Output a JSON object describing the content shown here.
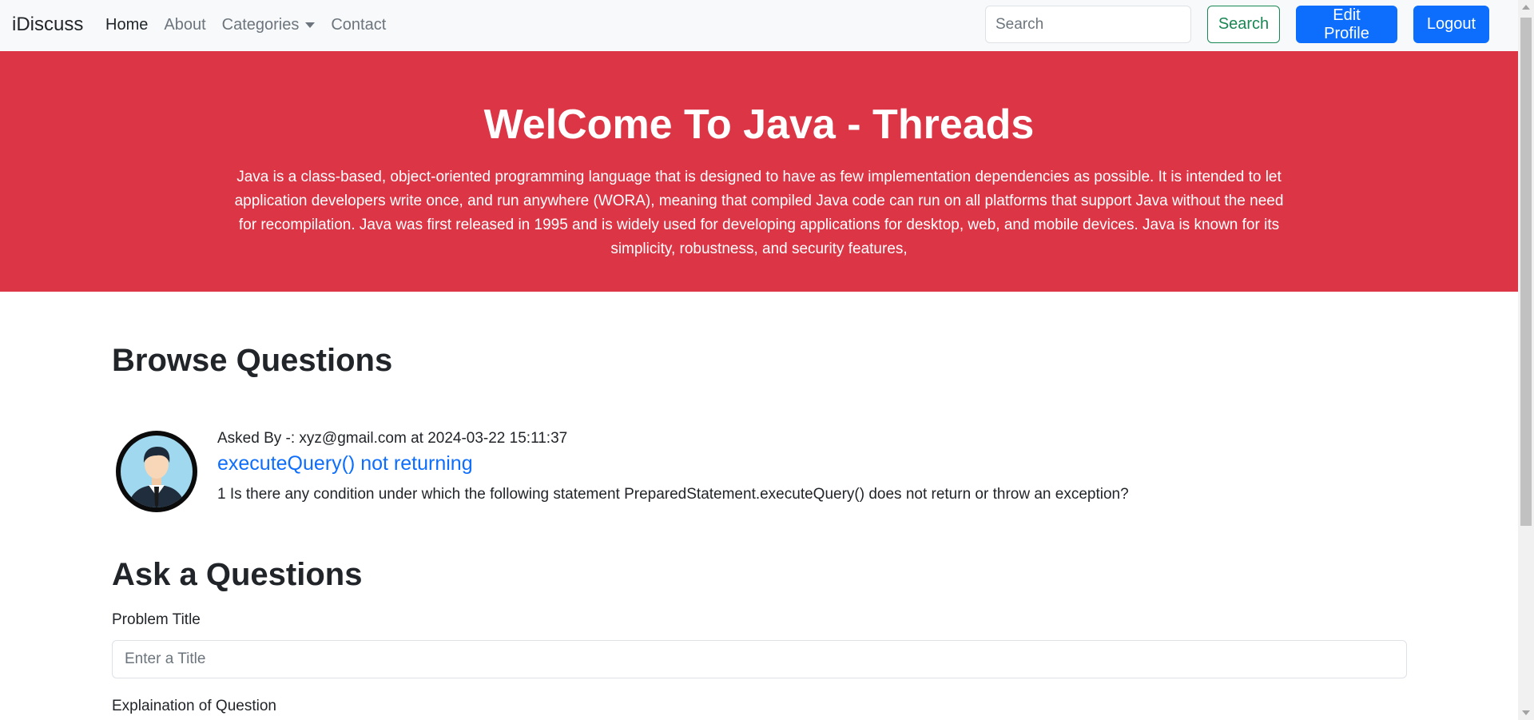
{
  "navbar": {
    "brand": "iDiscuss",
    "links": [
      {
        "label": "Home"
      },
      {
        "label": "About"
      },
      {
        "label": "Categories"
      },
      {
        "label": "Contact"
      }
    ],
    "search_placeholder": "Search",
    "search_button": "Search",
    "edit_profile_button": "Edit Profile",
    "logout_button": "Logout"
  },
  "hero": {
    "title": "WelCome To Java - Threads",
    "description": "Java is a class-based, object-oriented programming language that is designed to have as few implementation dependencies as possible. It is intended to let application developers write once, and run anywhere (WORA), meaning that compiled Java code can run on all platforms that support Java without the need for recompilation. Java was first released in 1995 and is widely used for developing applications for desktop, web, and mobile devices. Java is known for its simplicity, robustness, and security features,"
  },
  "browse": {
    "heading": "Browse Questions",
    "questions": [
      {
        "meta": "Asked By -: xyz@gmail.com at 2024-03-22 15:11:37",
        "title": "executeQuery() not returning",
        "description": "1 Is there any condition under which the following statement PreparedStatement.executeQuery() does not return or throw an exception?"
      }
    ]
  },
  "ask": {
    "heading": "Ask a Questions",
    "title_label": "Problem Title",
    "title_placeholder": "Enter a Title",
    "explanation_label": "Explaination of Question"
  },
  "colors": {
    "hero_bg": "#dc3545",
    "primary": "#0d6efd",
    "success": "#198754",
    "navbar_bg": "#f8f9fa"
  },
  "icons": {
    "avatar": "user-avatar-icon",
    "categories_caret": "caret-down-icon"
  }
}
